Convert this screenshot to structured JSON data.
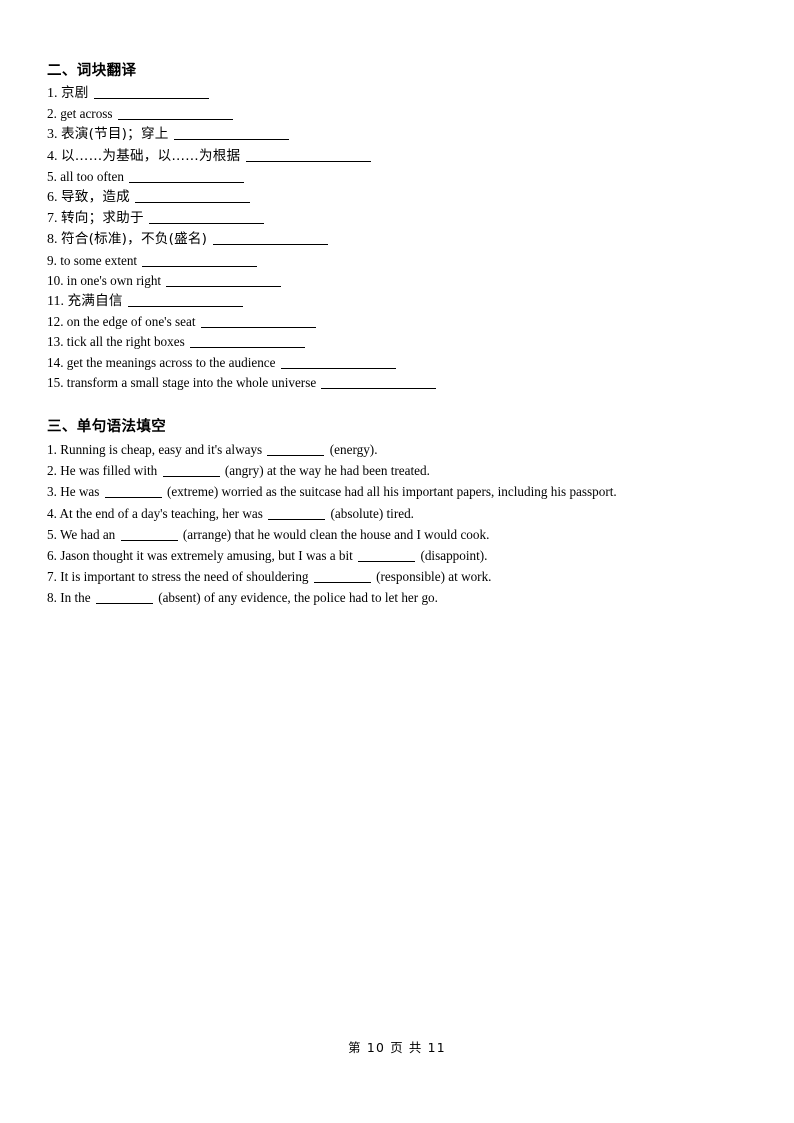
{
  "document": {
    "page_footer": "第 10 页 共 11"
  },
  "section_two": {
    "heading": "二、词块翻译",
    "items": [
      {
        "num": "1.",
        "text": "京剧",
        "blank": "long",
        "cjk": true
      },
      {
        "num": "2.",
        "text": "get across",
        "blank": "long",
        "cjk": false
      },
      {
        "num": "3.",
        "text": "表演(节目)；穿上",
        "blank": "long",
        "cjk": true
      },
      {
        "num": "4.",
        "text": "以……为基础，以……为根据",
        "blank": "xlong",
        "cjk": true
      },
      {
        "num": "5.",
        "text": "all too often",
        "blank": "long",
        "cjk": false
      },
      {
        "num": "6.",
        "text": "导致，造成",
        "blank": "long",
        "cjk": true
      },
      {
        "num": "7.",
        "text": "转向；求助于",
        "blank": "long",
        "cjk": true
      },
      {
        "num": "8.",
        "text": "符合(标准)，不负(盛名)",
        "blank": "long",
        "cjk": true
      },
      {
        "num": "9.",
        "text": "to some extent",
        "blank": "long",
        "cjk": false
      },
      {
        "num": "10.",
        "text": "in one's own right",
        "blank": "long",
        "cjk": false
      },
      {
        "num": "11.",
        "text": "充满自信",
        "blank": "long",
        "cjk": true
      },
      {
        "num": "12.",
        "text": "on the edge of one's seat",
        "blank": "long",
        "cjk": false
      },
      {
        "num": "13.",
        "text": "tick all the right boxes",
        "blank": "long",
        "cjk": false
      },
      {
        "num": "14.",
        "text": "get the meanings across to the audience",
        "blank": "long",
        "cjk": false
      },
      {
        "num": "15.",
        "text": "transform a small stage into the whole universe",
        "blank": "long",
        "cjk": false
      }
    ]
  },
  "section_three": {
    "heading": "三、单句语法填空",
    "items": [
      {
        "num": "1.",
        "before": "Running is cheap, easy and it's always",
        "after": "(energy).",
        "wrap": false
      },
      {
        "num": "2.",
        "before": "He was filled with",
        "after": "(angry) at the way he had been treated.",
        "wrap": false
      },
      {
        "num": "3.",
        "before": "He was",
        "after": "(extreme) worried as the suitcase had all his important papers, including his passport.",
        "wrap": true
      },
      {
        "num": "4.",
        "before": "At the end of a day's teaching, her was",
        "after": "(absolute) tired.",
        "wrap": false
      },
      {
        "num": "5.",
        "before": "We had an",
        "after": "(arrange) that he would clean the house and I would cook.",
        "wrap": false
      },
      {
        "num": "6.",
        "before": "Jason thought it was extremely amusing, but I was a bit",
        "after": "(disappoint).",
        "wrap": false
      },
      {
        "num": "7.",
        "before": "It is important to stress the need of shouldering",
        "after": "(responsible) at work.",
        "wrap": false
      },
      {
        "num": "8.",
        "before": "In the",
        "after": "(absent) of any evidence, the police had to let her go.",
        "wrap": false
      }
    ]
  }
}
